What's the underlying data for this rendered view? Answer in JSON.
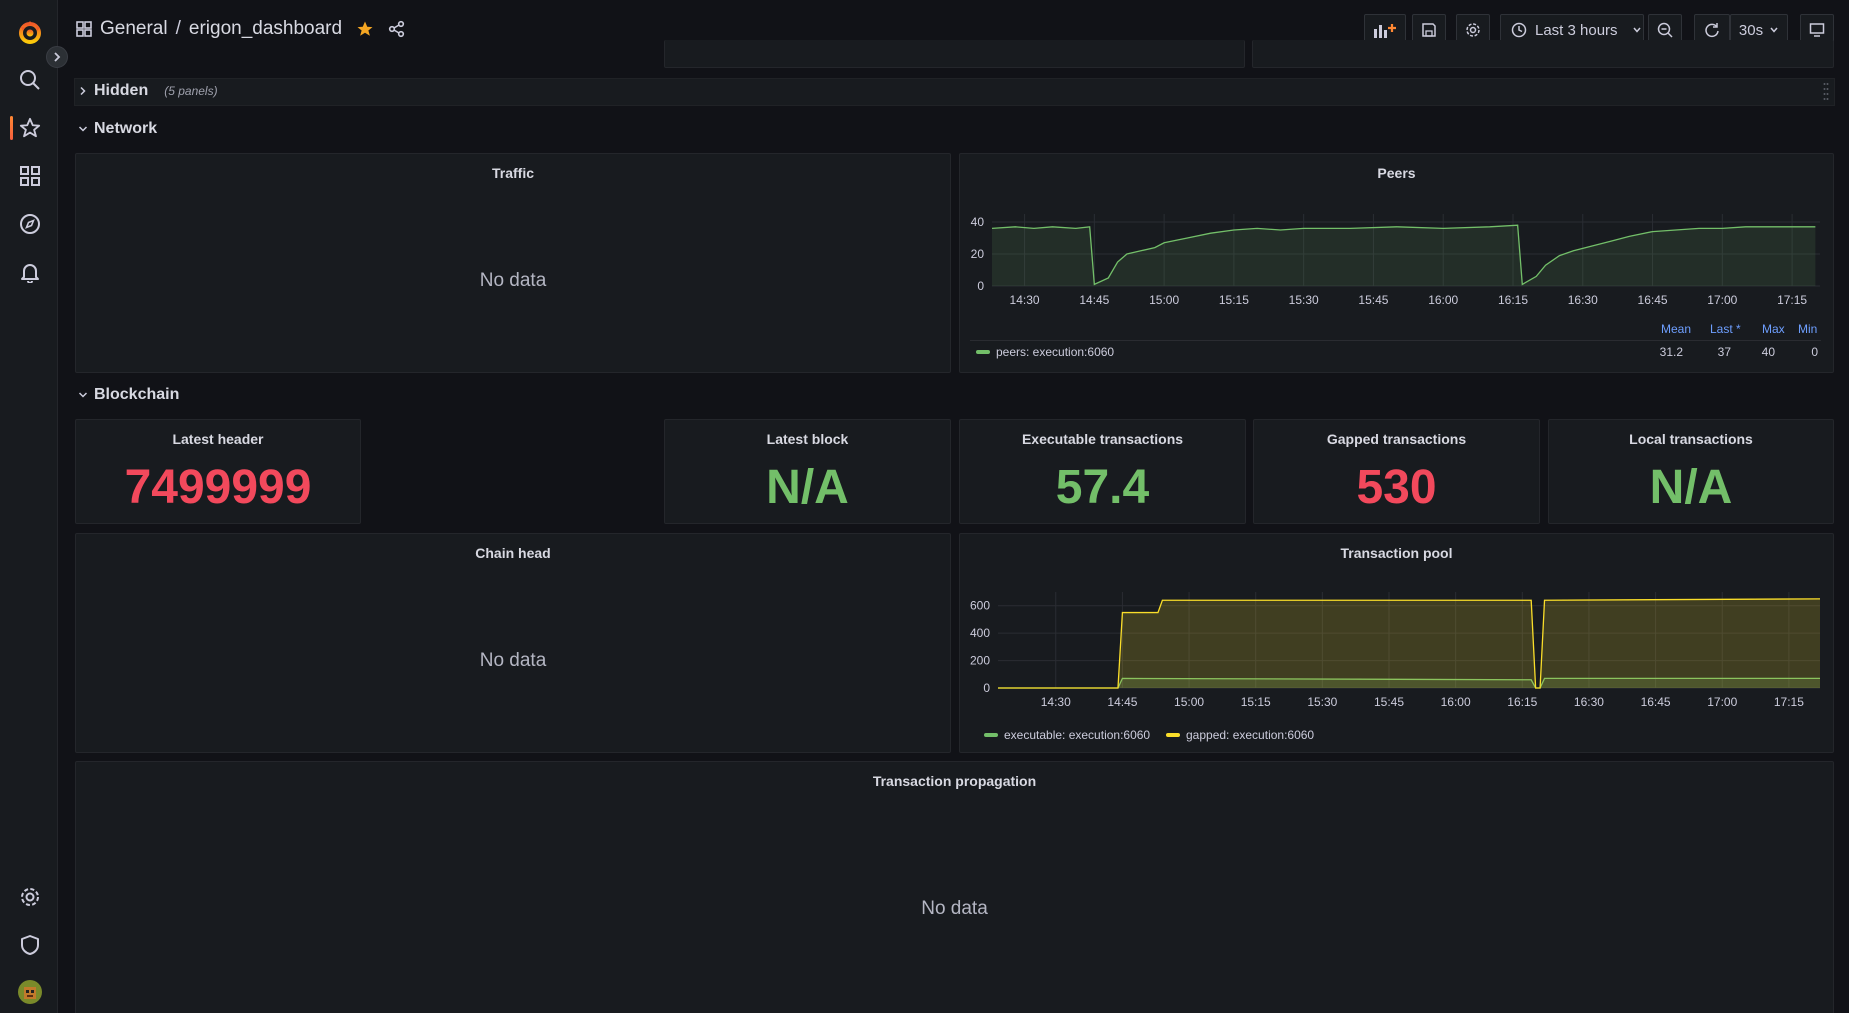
{
  "breadcrumb": {
    "folder": "General",
    "separator": "/",
    "dashboard": "erigon_dashboard"
  },
  "toolbar": {
    "time_range": "Last 3 hours",
    "refresh_interval": "30s"
  },
  "rows": {
    "hidden": {
      "title": "Hidden",
      "subtitle": "(5 panels)"
    },
    "network": {
      "title": "Network"
    },
    "blockchain": {
      "title": "Blockchain"
    }
  },
  "panels": {
    "traffic": {
      "title": "Traffic",
      "no_data": "No data"
    },
    "peers": {
      "title": "Peers",
      "legend_headers": [
        "Mean",
        "Last *",
        "Max",
        "Min"
      ],
      "series_name": "peers: execution:6060",
      "stats": [
        "31.2",
        "37",
        "40",
        "0"
      ]
    },
    "latest_header": {
      "title": "Latest header",
      "value": "7499999",
      "color": "#f2495c"
    },
    "latest_block": {
      "title": "Latest block",
      "value": "N/A",
      "color": "#73bf69"
    },
    "executable_tx": {
      "title": "Executable transactions",
      "value": "57.4",
      "color": "#73bf69"
    },
    "gapped_tx": {
      "title": "Gapped transactions",
      "value": "530",
      "color": "#f2495c"
    },
    "local_tx": {
      "title": "Local transactions",
      "value": "N/A",
      "color": "#73bf69"
    },
    "chain_head": {
      "title": "Chain head",
      "no_data": "No data"
    },
    "tx_pool": {
      "title": "Transaction pool",
      "legend": [
        "executable: execution:6060",
        "gapped: execution:6060"
      ]
    },
    "tx_propagation": {
      "title": "Transaction propagation",
      "no_data": "No data"
    }
  },
  "colors": {
    "green": "#73bf69",
    "yellow": "#fade2a",
    "red": "#f2495c",
    "accent": "#ff7f50"
  },
  "chart_data": [
    {
      "type": "line",
      "title": "Peers",
      "x_ticks": [
        "14:30",
        "14:45",
        "15:00",
        "15:15",
        "15:30",
        "15:45",
        "16:00",
        "16:15",
        "16:30",
        "16:45",
        "17:00",
        "17:15"
      ],
      "ylim": [
        0,
        45
      ],
      "y_ticks": [
        0,
        20,
        40
      ],
      "series": [
        {
          "name": "peers: execution:6060",
          "color": "#73bf69",
          "x": [
            "14:23",
            "14:28",
            "14:32",
            "14:36",
            "14:41",
            "14:44",
            "14:45",
            "14:48",
            "14:50",
            "14:52",
            "14:55",
            "14:58",
            "15:00",
            "15:05",
            "15:10",
            "15:15",
            "15:20",
            "15:25",
            "15:30",
            "15:40",
            "15:50",
            "16:00",
            "16:10",
            "16:16",
            "16:17",
            "16:20",
            "16:22",
            "16:25",
            "16:28",
            "16:32",
            "16:36",
            "16:40",
            "16:45",
            "16:50",
            "16:55",
            "17:00",
            "17:05",
            "17:10",
            "17:15",
            "17:20"
          ],
          "y": [
            36,
            37,
            36,
            37,
            36,
            37,
            1,
            5,
            15,
            20,
            22,
            24,
            27,
            30,
            33,
            35,
            36,
            35,
            36,
            36,
            37,
            36,
            37,
            38,
            1,
            6,
            13,
            19,
            22,
            25,
            28,
            31,
            34,
            35,
            36,
            36,
            37,
            37,
            37,
            37
          ]
        }
      ]
    },
    {
      "type": "area",
      "title": "Transaction pool",
      "x_ticks": [
        "14:30",
        "14:45",
        "15:00",
        "15:15",
        "15:30",
        "15:45",
        "16:00",
        "16:15",
        "16:30",
        "16:45",
        "17:00",
        "17:15"
      ],
      "ylim": [
        0,
        700
      ],
      "y_ticks": [
        0,
        200,
        400,
        600
      ],
      "series": [
        {
          "name": "executable: execution:6060",
          "color": "#73bf69",
          "x": [
            "14:17",
            "14:44",
            "14:45",
            "16:17",
            "16:18",
            "16:19",
            "16:20",
            "17:22"
          ],
          "y": [
            0,
            0,
            70,
            60,
            0,
            0,
            70,
            70
          ]
        },
        {
          "name": "gapped: execution:6060",
          "color": "#fade2a",
          "x": [
            "14:17",
            "14:44",
            "14:45",
            "14:53",
            "14:54",
            "16:17",
            "16:18",
            "16:19",
            "16:20",
            "17:22"
          ],
          "y": [
            0,
            0,
            550,
            550,
            640,
            640,
            0,
            0,
            640,
            650
          ]
        }
      ]
    }
  ]
}
